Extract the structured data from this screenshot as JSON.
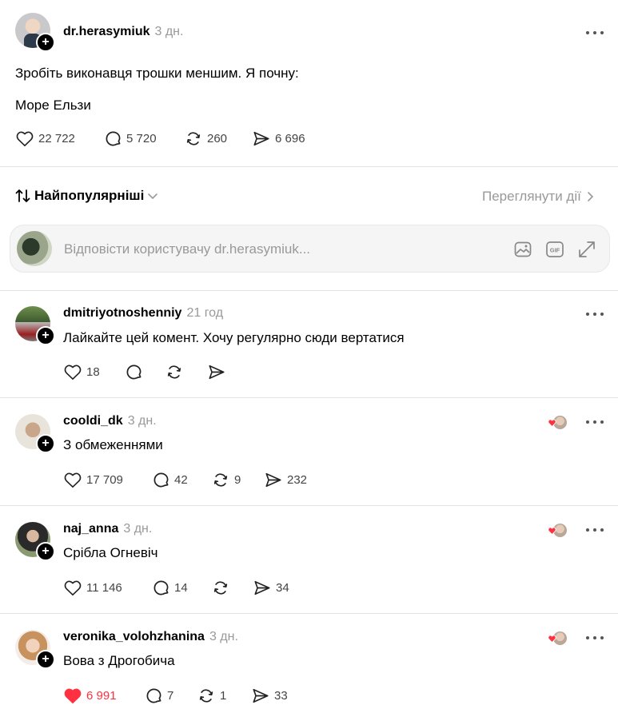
{
  "post": {
    "username": "dr.herasymiuk",
    "time": "3 дн.",
    "text_line1": "Зробіть виконавця трошки меншим. Я почну:",
    "text_line2": "Море Ельзи",
    "likes": "22 722",
    "replies": "5 720",
    "reposts": "260",
    "shares": "6 696"
  },
  "sort": {
    "label": "Найпопулярніші",
    "view_activity": "Переглянути дії"
  },
  "reply_box": {
    "placeholder": "Відповісти користувачу dr.herasymiuk..."
  },
  "comments": [
    {
      "username": "dmitriyotnoshenniy",
      "time": "21 год",
      "text": "Лайкайте цей комент. Хочу регулярно сюди вертатися",
      "likes": "18",
      "replies": "",
      "reposts": "",
      "shares": "",
      "liked": false,
      "author_liked": false
    },
    {
      "username": "cooldi_dk",
      "time": "3 дн.",
      "text": "З обмеженнями",
      "likes": "17 709",
      "replies": "42",
      "reposts": "9",
      "shares": "232",
      "liked": false,
      "author_liked": true
    },
    {
      "username": "naj_anna",
      "time": "3 дн.",
      "text": "Срібла Огневіч",
      "likes": "11 146",
      "replies": "14",
      "reposts": "",
      "shares": "34",
      "liked": false,
      "author_liked": true
    },
    {
      "username": "veronika_volohzhanina",
      "time": "3 дн.",
      "text": "Вова з Дрогобича",
      "likes": "6 991",
      "replies": "7",
      "reposts": "1",
      "shares": "33",
      "liked": true,
      "author_liked": true
    }
  ],
  "colors": {
    "liked": "#ff3040",
    "muted": "#999999",
    "divider": "#e3e3e3"
  }
}
